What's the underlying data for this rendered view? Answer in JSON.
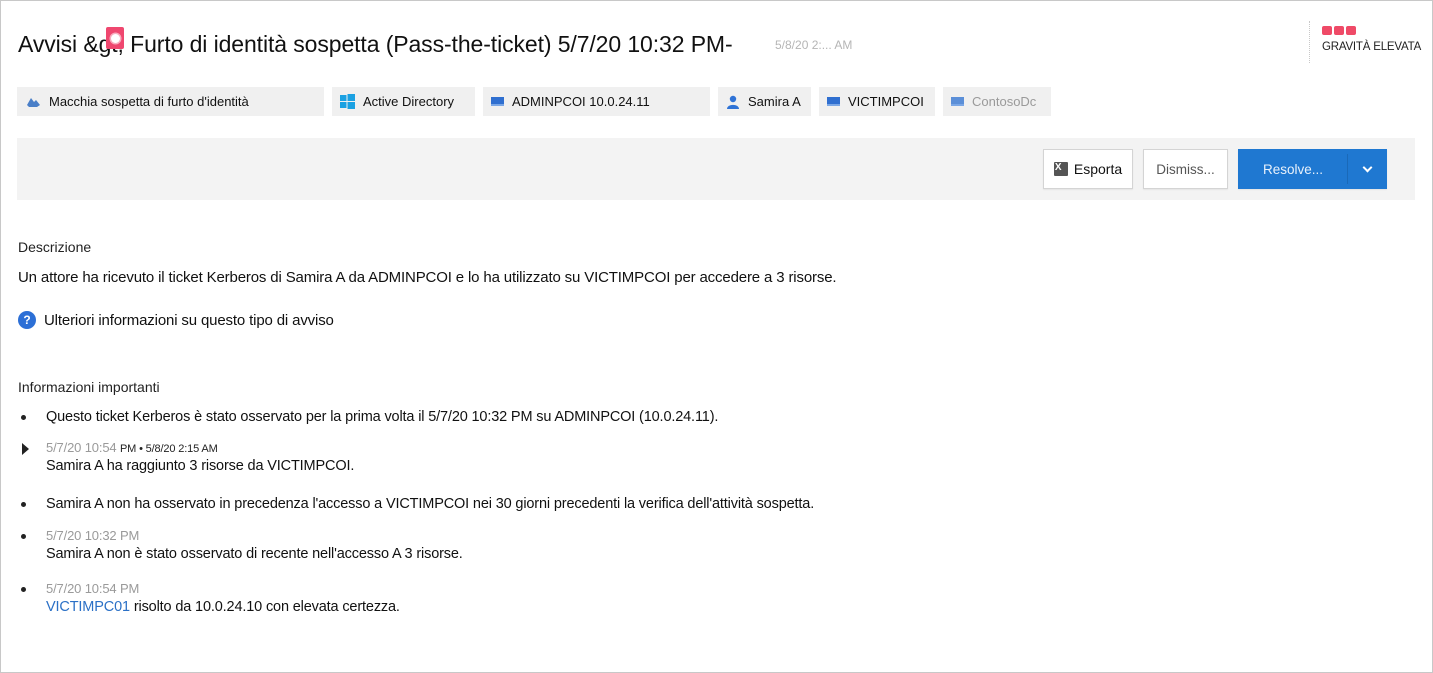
{
  "header": {
    "title": "Avvisi &gt;  Furto di identità sospetta (Pass-the-ticket) 5/7/20 10:32 PM-",
    "title_ghost_text": "5/8/20 2:... AM",
    "alert_badge_icon": "alert-badge-icon",
    "severity": {
      "label": "GRAVITÀ ELEVATA",
      "bars": 3,
      "color": "#ef4a67"
    }
  },
  "chips": [
    {
      "icon": "identity-theft-icon",
      "label": "Macchia sospetta di furto d'identità",
      "muted": false
    },
    {
      "icon": "windows-icon",
      "label": "Active Directory",
      "muted": false
    },
    {
      "icon": "computer-icon",
      "label": "ADMINPCOI 10.0.24.11",
      "muted": false
    },
    {
      "icon": "user-icon",
      "label": "Samira A",
      "muted": false
    },
    {
      "icon": "computer-icon",
      "label": "VICTIMPCOI",
      "muted": false
    },
    {
      "icon": "computer-icon",
      "label": "ContosoDc",
      "muted": true
    }
  ],
  "toolbar": {
    "export_label": "Esporta",
    "dismiss_label": "Dismiss...",
    "resolve_label": "Resolve...",
    "accent_color": "#1f78d1"
  },
  "description": {
    "heading": "Descrizione",
    "text": "Un attore ha ricevuto il ticket Kerberos di Samira A da ADMINPCOI e lo ha utilizzato su VICTIMPCOI per accedere a 3 risorse.",
    "learn_more": "Ulteriori informazioni su questo tipo di avviso"
  },
  "important": {
    "heading": "Informazioni importanti",
    "items": [
      {
        "marker": "bullet",
        "text": "Questo ticket Kerberos è stato osservato per la prima volta il 5/7/20 10:32 PM su ADMINPCOI (10.0.24.11)."
      },
      {
        "marker": "expand",
        "timestamp": "5/7/20 10:54",
        "timestamp_suffix": "PM • 5/8/20 2:15 AM",
        "text": "Samira A ha raggiunto 3 risorse da VICTIMPCOI."
      },
      {
        "marker": "bullet",
        "text": "Samira A non ha osservato in precedenza l'accesso a VICTIMPCOI nei 30 giorni precedenti la verifica dell'attività sospetta."
      },
      {
        "marker": "bullet",
        "timestamp": "5/7/20 10:32 PM",
        "text": "Samira A non è stato osservato di recente nell'accesso A 3 risorse."
      },
      {
        "marker": "bullet",
        "timestamp": "5/7/20 10:54 PM",
        "link": "VICTIMPC01",
        "text": "risolto da 10.0.24.10 con elevata certezza."
      }
    ]
  }
}
